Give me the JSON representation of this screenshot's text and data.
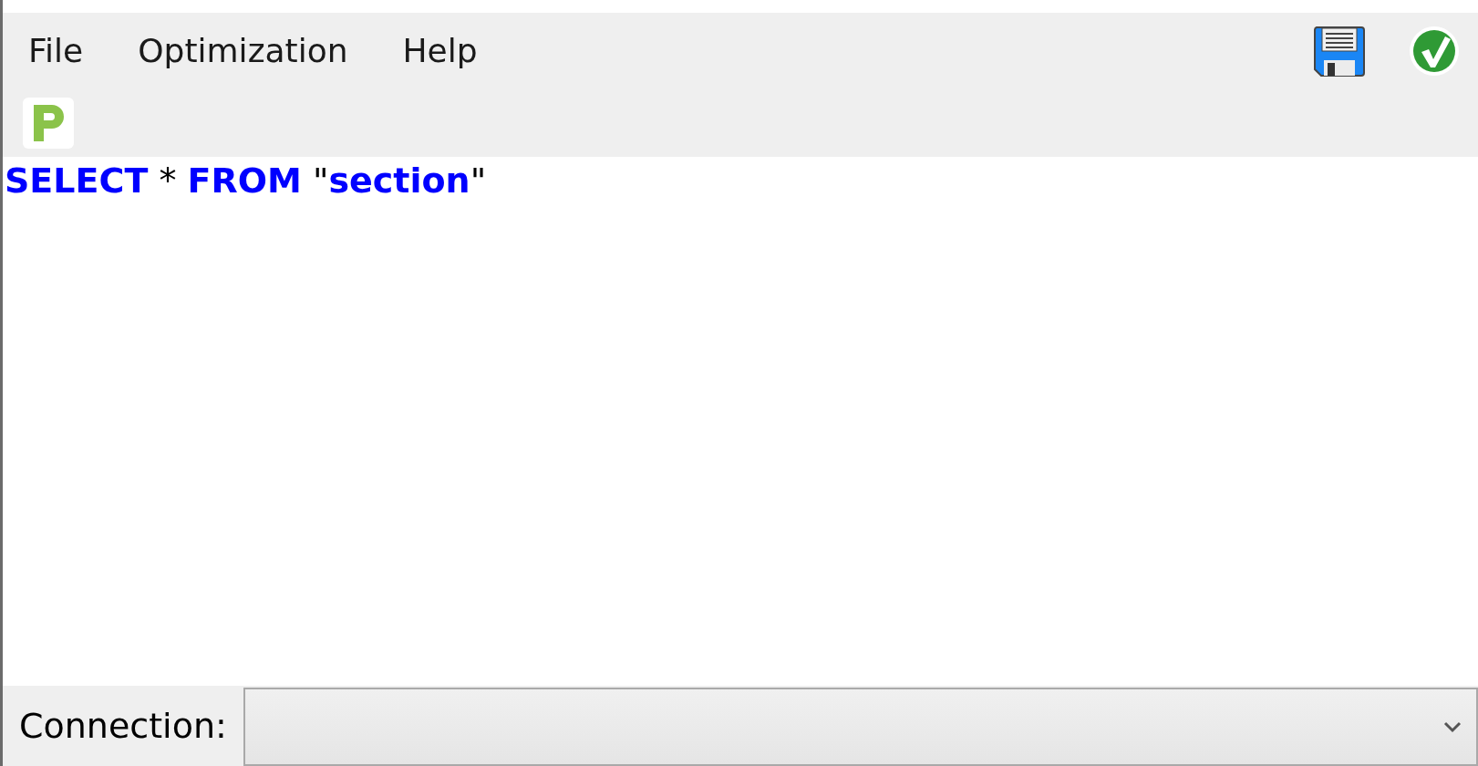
{
  "menu": [
    {
      "label": "File"
    },
    {
      "label": "Optimization"
    },
    {
      "label": "Help"
    }
  ],
  "editor": {
    "lines": [
      [
        {
          "text": "SELECT",
          "kind": "keyword"
        },
        {
          "text": " * ",
          "kind": "plain"
        },
        {
          "text": "FROM",
          "kind": "keyword"
        },
        {
          "text": " \"",
          "kind": "plain"
        },
        {
          "text": "section",
          "kind": "identifier"
        },
        {
          "text": "\"",
          "kind": "plain"
        }
      ]
    ]
  },
  "connection": {
    "label": "Connection:"
  }
}
